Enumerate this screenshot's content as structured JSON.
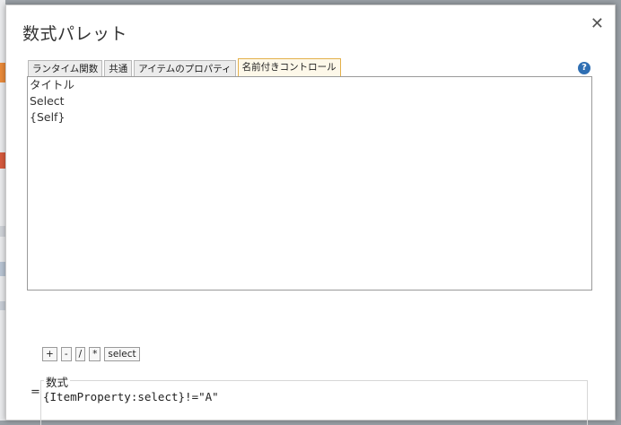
{
  "dialog": {
    "title": "数式パレット",
    "close_glyph": "✕",
    "help_glyph": "?"
  },
  "tabs": [
    {
      "label": "ランタイム関数",
      "active": false
    },
    {
      "label": "共通",
      "active": false
    },
    {
      "label": "アイテムのプロパティ",
      "active": false
    },
    {
      "label": "名前付きコントロール",
      "active": true
    }
  ],
  "list": {
    "items": [
      "タイトル",
      "Select",
      "{Self}"
    ]
  },
  "operators": [
    "+",
    "-",
    "/",
    "*",
    "select"
  ],
  "formula": {
    "equals": "=",
    "legend": "数式",
    "value": "{ItemProperty:select}!=\"A\""
  },
  "colors": {
    "active_tab_border": "#e3b04b",
    "help_icon": "#2f6fb3"
  }
}
